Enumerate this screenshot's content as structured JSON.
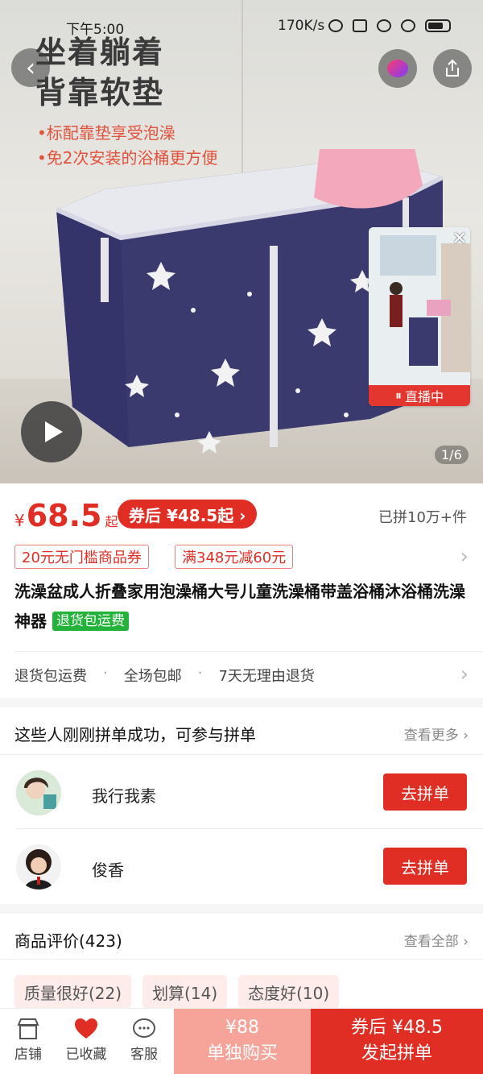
{
  "statusbar": {
    "time": "下午5:00",
    "speed": "170K/s"
  },
  "hero": {
    "headline_line1": "坐着躺着",
    "headline_line2": "背靠软垫",
    "bullet1": "•标配靠垫享受泡澡",
    "bullet2": "•免2次安装的浴桶更方便",
    "live_label": "直播中",
    "counter": "1/6"
  },
  "price": {
    "currency": "¥",
    "amount": "68.5",
    "suffix": "起",
    "after_coupon": "券后 ¥48.5起 ›",
    "sold": "已拼10万+件",
    "tag1": "20元无门槛商品券",
    "tag2": "满348元减60元",
    "title": "洗澡盆成人折叠家用泡澡桶大号儿童洗澡桶带盖浴桶沐浴桶洗澡神器",
    "title_badge": "退货包运费",
    "services": [
      "退货包运费",
      "全场包邮",
      "7天无理由退货"
    ],
    "service_sep": "·"
  },
  "group": {
    "title": "这些人刚刚拼单成功，可参与拼单",
    "more": "查看更多 ›",
    "members": [
      {
        "name": "我行我素",
        "action": "去拼单"
      },
      {
        "name": "俊香",
        "action": "去拼单"
      }
    ]
  },
  "reviews": {
    "title": "商品评价(423)",
    "more": "查看全部 ›",
    "chips": [
      "质量很好(22)",
      "划算(14)",
      "态度好(10)"
    ]
  },
  "bottom": {
    "shop": "店铺",
    "fav": "已收藏",
    "cs": "客服",
    "solo_price": "¥88",
    "solo_label": "单独购买",
    "group_price": "券后 ¥48.5",
    "group_label": "发起拼单"
  },
  "colors": {
    "accent": "#e02e24",
    "badge_green": "#23b33a",
    "solo_bg": "#f6a49a"
  }
}
